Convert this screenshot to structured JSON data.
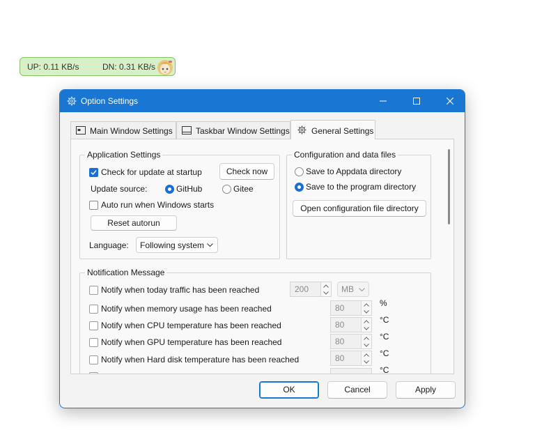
{
  "monitor": {
    "up": "UP: 0.11 KB/s",
    "dn": "DN: 0.31 KB/s"
  },
  "window": {
    "title": "Option Settings"
  },
  "tabs": [
    {
      "label": "Main Window Settings"
    },
    {
      "label": "Taskbar Window Settings"
    },
    {
      "label": "General Settings"
    }
  ],
  "app_settings": {
    "legend": "Application Settings",
    "check_update_label": "Check for update at startup",
    "check_now_label": "Check now",
    "update_source_label": "Update source:",
    "github_label": "GitHub",
    "gitee_label": "Gitee",
    "autorun_label": "Auto run when Windows starts",
    "reset_autorun_label": "Reset autorun",
    "language_label": "Language:",
    "language_value": "Following system"
  },
  "config_files": {
    "legend": "Configuration and data files",
    "appdata_label": "Save to Appdata directory",
    "program_dir_label": "Save to the program directory",
    "open_dir_label": "Open configuration file directory"
  },
  "notify": {
    "legend": "Notification Message",
    "traffic_label": "Notify when today traffic has been reached",
    "traffic_value": "200",
    "traffic_unit": "MB",
    "memory_label": "Notify when memory usage has been reached",
    "memory_value": "80",
    "memory_unit": "%",
    "cpu_label": "Notify when CPU temperature has been reached",
    "cpu_value": "80",
    "cpu_unit": "°C",
    "gpu_label": "Notify when GPU temperature has been reached",
    "gpu_value": "80",
    "gpu_unit": "°C",
    "disk_label": "Notify when Hard disk temperature has been reached",
    "disk_value": "80",
    "disk_unit": "°C",
    "extra_unit": "°C"
  },
  "buttons": {
    "ok": "OK",
    "cancel": "Cancel",
    "apply": "Apply"
  }
}
